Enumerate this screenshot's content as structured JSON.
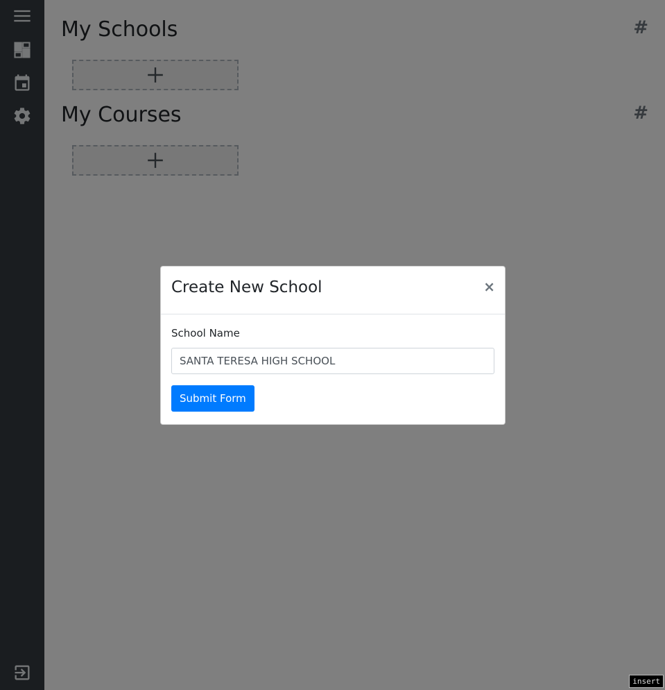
{
  "sidebar": {
    "icons": [
      "hamburger-menu-icon",
      "dashboard-icon",
      "calendar-icon",
      "gear-icon",
      "logout-icon"
    ]
  },
  "main": {
    "schools_title": "My Schools",
    "courses_title": "My Courses",
    "hash_symbol": "#"
  },
  "modal": {
    "title": "Create New School",
    "close_symbol": "×",
    "field_label": "School Name",
    "field_value": "SANTA TERESA HIGH SCHOOL",
    "submit_label": "Submit Form"
  },
  "status": {
    "mode": "insert"
  },
  "colors": {
    "sidebar_bg": "#343a40",
    "primary": "#007bff",
    "backdrop": "rgba(0,0,0,0.5)"
  }
}
